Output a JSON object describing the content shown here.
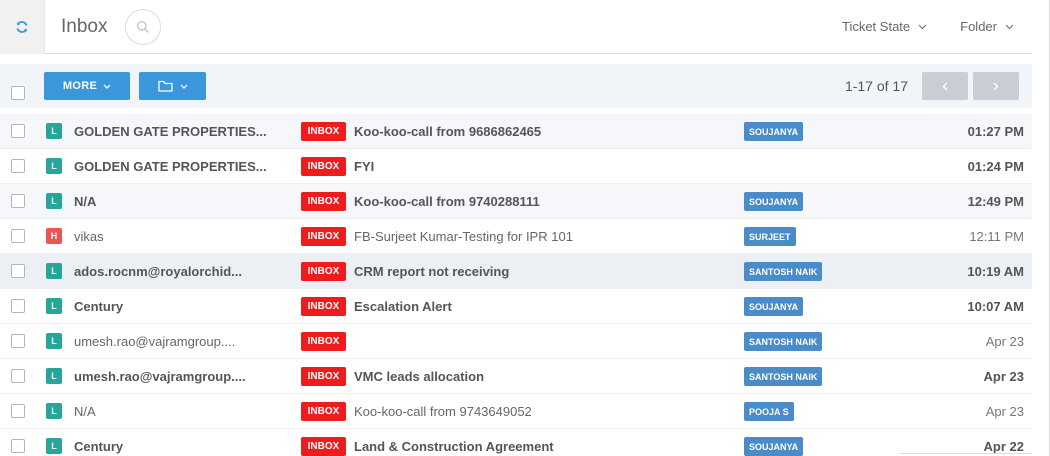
{
  "header": {
    "title": "Inbox",
    "refresh_icon": "refresh-icon",
    "search_icon": "search-icon",
    "ticket_state_label": "Ticket State",
    "folder_label": "Folder"
  },
  "toolbar": {
    "more_label": "MORE",
    "folder_icon": "folder-icon",
    "pagination": "1-17 of 17",
    "prev_icon": "chevron-left-icon",
    "next_icon": "chevron-right-icon"
  },
  "colors": {
    "accent_blue": "#3a97dc",
    "inbox_red": "#ee1c1c",
    "agent_blue": "#4a8bc9",
    "priority_low": "#26a69a",
    "priority_high": "#ef5350"
  },
  "tickets": [
    {
      "priority": "L",
      "sender": "GOLDEN GATE PROPERTIES...",
      "tag": "INBOX",
      "subject": "Koo-koo-call from 9686862465",
      "agent": "SOUJANYA",
      "time": "01:27 PM",
      "unread": true
    },
    {
      "priority": "L",
      "sender": "GOLDEN GATE PROPERTIES...",
      "tag": "INBOX",
      "subject": "FYI",
      "agent": "",
      "time": "01:24 PM",
      "unread": true
    },
    {
      "priority": "L",
      "sender": "N/A",
      "tag": "INBOX",
      "subject": "Koo-koo-call from 9740288111",
      "agent": "SOUJANYA",
      "time": "12:49 PM",
      "unread": true
    },
    {
      "priority": "H",
      "sender": "vikas",
      "tag": "INBOX",
      "subject": "FB-Surjeet Kumar-Testing for IPR 101",
      "agent": "SURJEET",
      "time": "12:11 PM",
      "unread": false
    },
    {
      "priority": "L",
      "sender": "ados.rocnm@royalorchid...",
      "tag": "INBOX",
      "subject": "CRM report not receiving",
      "agent": "SANTOSH NAIK",
      "time": "10:19 AM",
      "unread": true
    },
    {
      "priority": "L",
      "sender": "Century",
      "tag": "INBOX",
      "subject": "Escalation Alert",
      "agent": "SOUJANYA",
      "time": "10:07 AM",
      "unread": true
    },
    {
      "priority": "L",
      "sender": "umesh.rao@vajramgroup....",
      "tag": "INBOX",
      "subject": "",
      "agent": "SANTOSH NAIK",
      "time": "Apr 23",
      "unread": false
    },
    {
      "priority": "L",
      "sender": "umesh.rao@vajramgroup....",
      "tag": "INBOX",
      "subject": "VMC leads allocation",
      "agent": "SANTOSH NAIK",
      "time": "Apr 23",
      "unread": true
    },
    {
      "priority": "L",
      "sender": "N/A",
      "tag": "INBOX",
      "subject": "Koo-koo-call from 9743649052",
      "agent": "POOJA S",
      "time": "Apr 23",
      "unread": false
    },
    {
      "priority": "L",
      "sender": "Century",
      "tag": "INBOX",
      "subject": "Land & Construction Agreement",
      "agent": "SOUJANYA",
      "time": "Apr 22",
      "unread": true
    }
  ]
}
